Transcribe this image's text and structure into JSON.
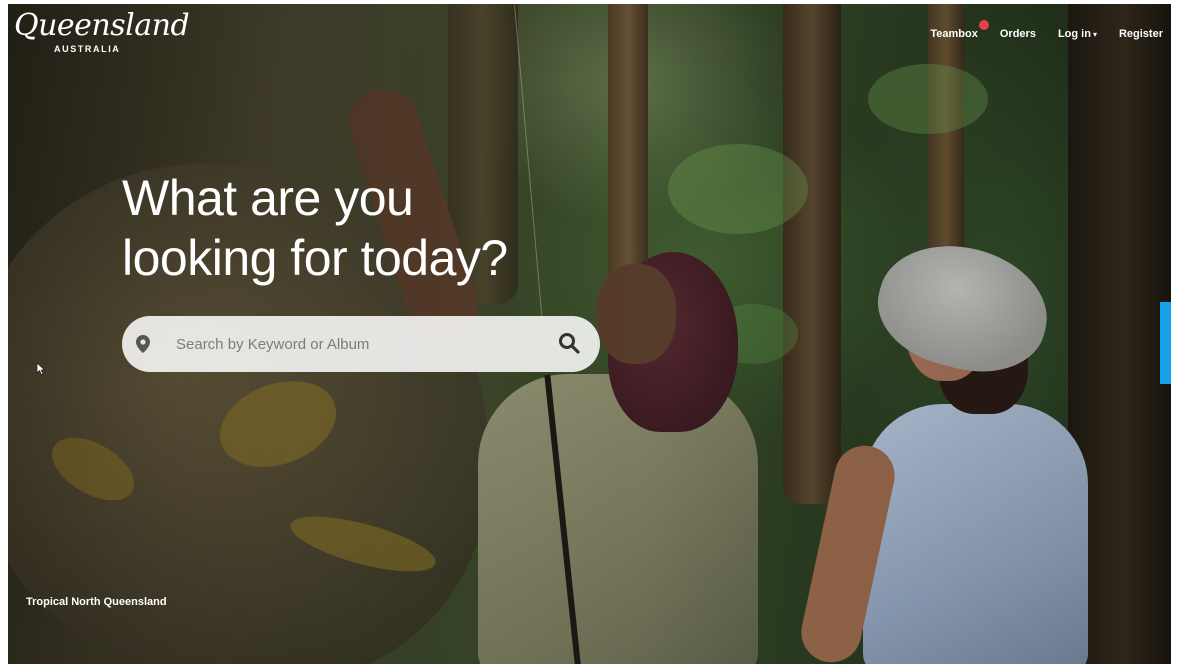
{
  "brand": {
    "wordmark": "Queensland",
    "subtitle": "AUSTRALIA"
  },
  "nav": {
    "items": [
      {
        "label": "Teambox",
        "badge_color": "#e8414b"
      },
      {
        "label": "Orders"
      },
      {
        "label": "Log in",
        "has_dropdown": true
      },
      {
        "label": "Register"
      }
    ],
    "dropdown_caret": "▾"
  },
  "hero": {
    "title_line1": "What are you",
    "title_line2": "looking for today?"
  },
  "search": {
    "placeholder": "Search by Keyword or Album",
    "value": "",
    "leading_icon": "map-pin-icon",
    "button_icon": "search-icon"
  },
  "caption": "Tropical North Queensland",
  "colors": {
    "accent_tab": "#1aa0e8",
    "badge": "#e8414b",
    "text": "#ffffff"
  }
}
